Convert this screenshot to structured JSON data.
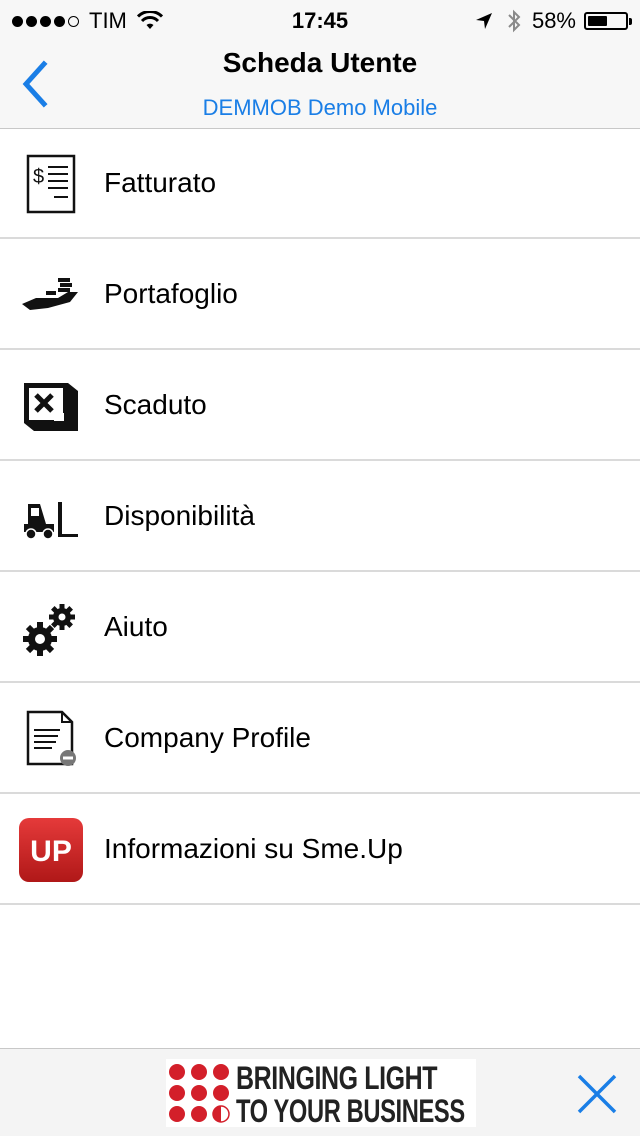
{
  "status_bar": {
    "carrier": "TIM",
    "time": "17:45",
    "battery_percent": "58%",
    "battery_level": 0.58,
    "signal_bars_filled": 4,
    "signal_bars_total": 5,
    "icons": [
      "signal-dots",
      "wifi-icon",
      "location-arrow-icon",
      "bluetooth-icon",
      "battery-icon"
    ]
  },
  "nav": {
    "title": "Scheda Utente",
    "subtitle": "DEMMOB Demo Mobile",
    "back_icon": "chevron-left-icon",
    "accent_color": "#1a7ee6"
  },
  "menu": {
    "items": [
      {
        "label": "Fatturato",
        "icon": "invoice-icon"
      },
      {
        "label": "Portafoglio",
        "icon": "hand-coins-icon"
      },
      {
        "label": "Scaduto",
        "icon": "expired-box-icon"
      },
      {
        "label": "Disponibilità",
        "icon": "forklift-icon"
      },
      {
        "label": "Aiuto",
        "icon": "gears-icon"
      },
      {
        "label": "Company Profile",
        "icon": "document-icon"
      },
      {
        "label": "Informazioni su Sme.Up",
        "icon": "smeup-logo-icon"
      }
    ]
  },
  "ad": {
    "line1": "BRINGING LIGHT",
    "line2": "TO YOUR BUSINESS",
    "close_icon": "close-icon",
    "brand_color": "#d31f2a"
  },
  "app_logo_text": "UP"
}
